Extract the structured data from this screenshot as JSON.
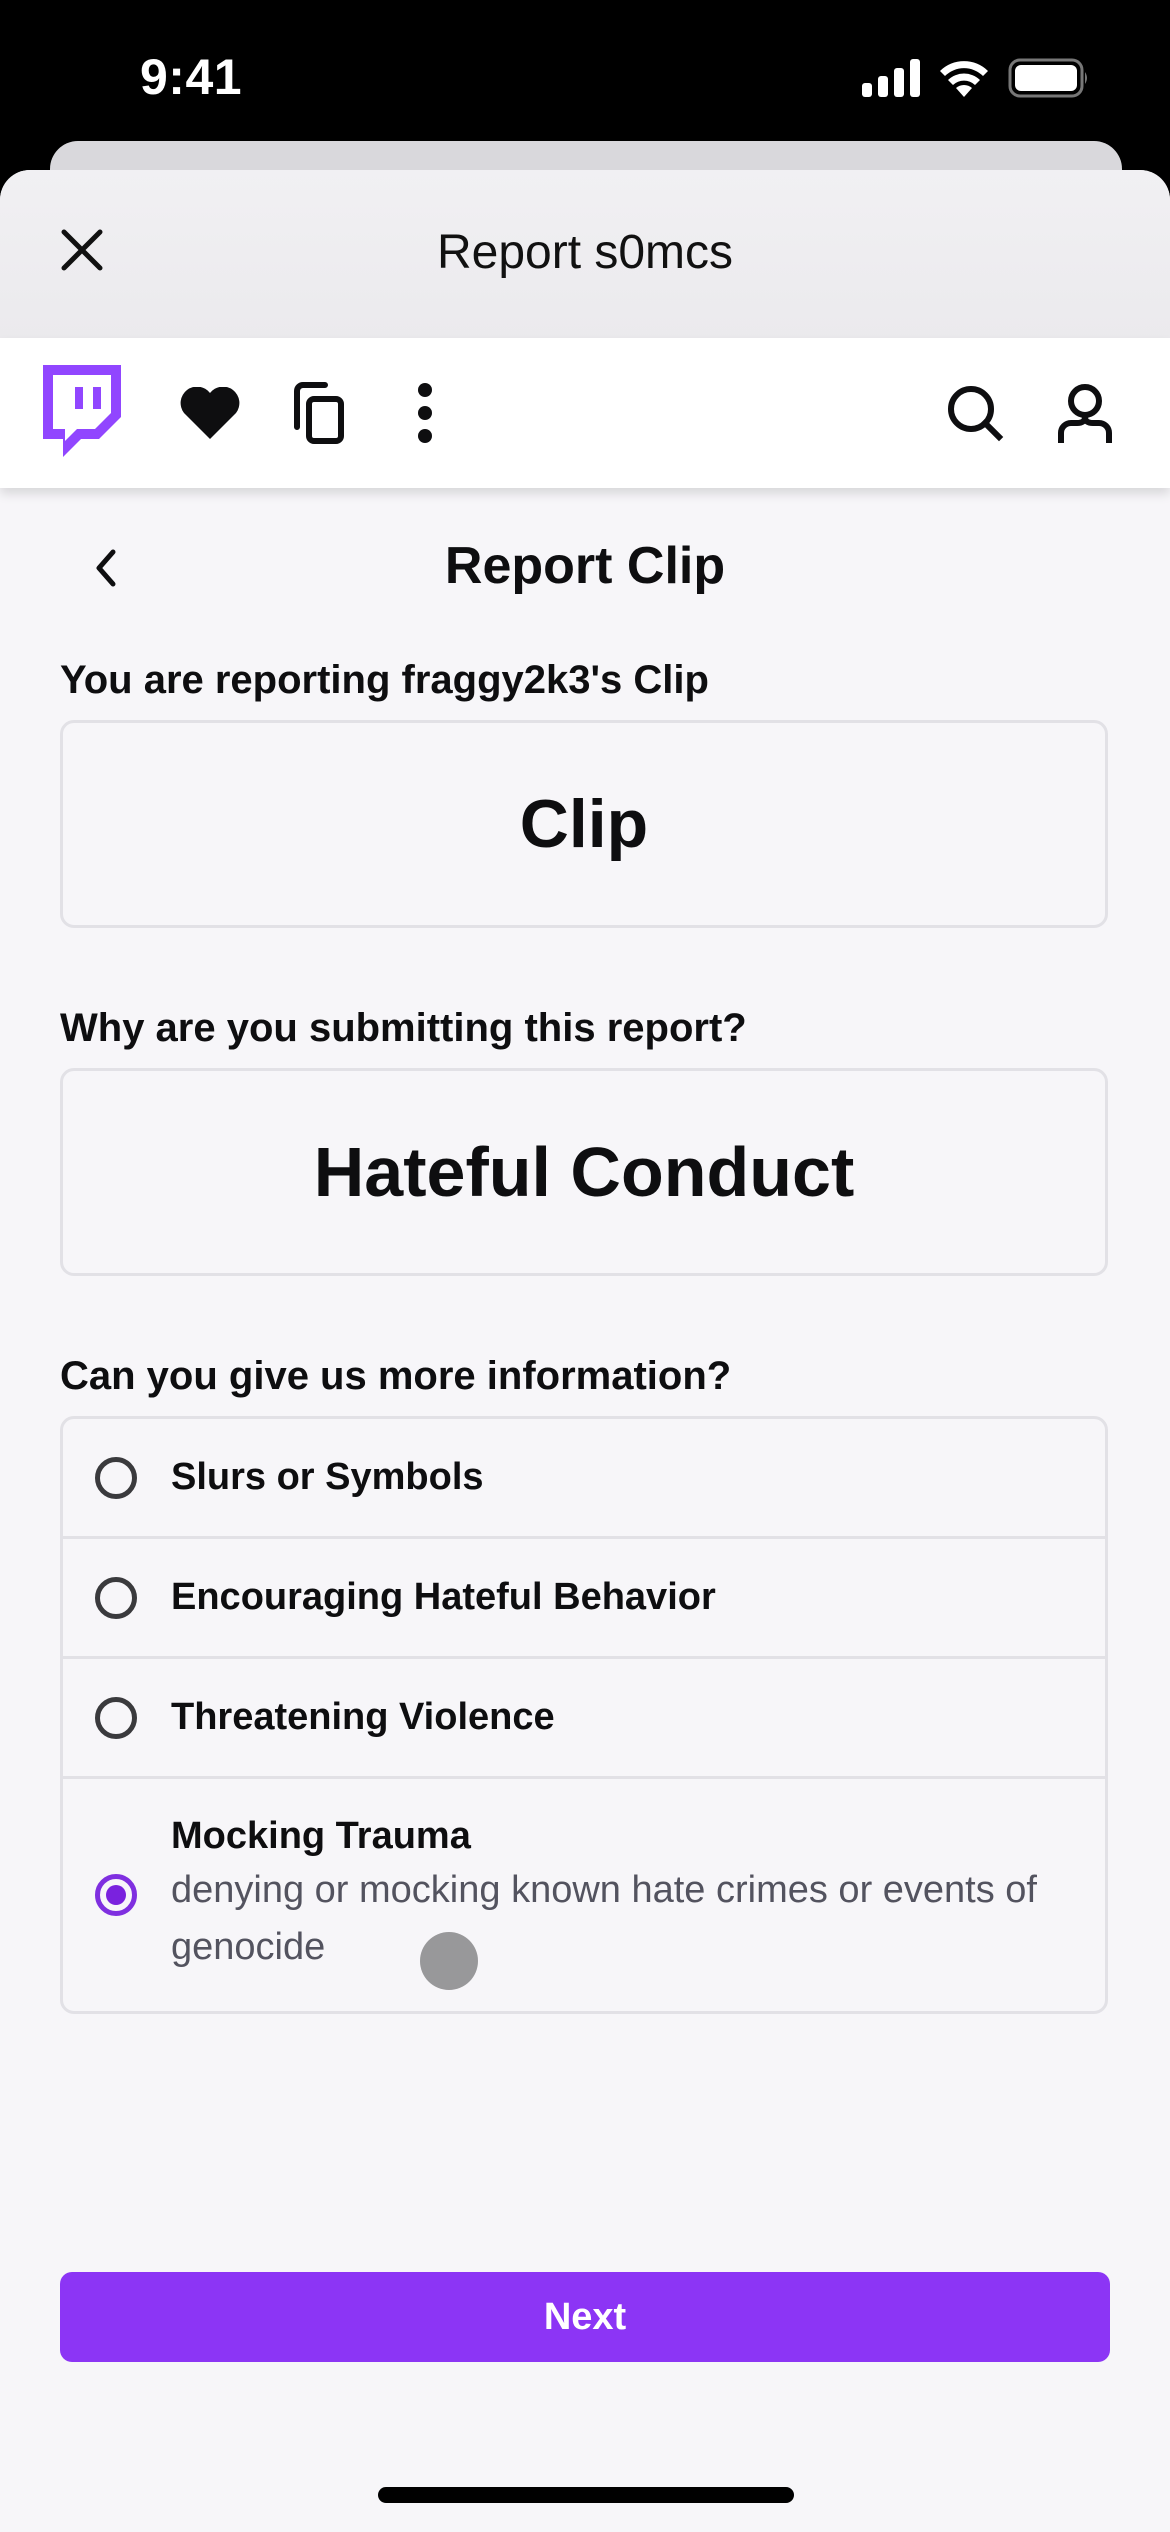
{
  "status_bar": {
    "time": "9:41",
    "icons": [
      "cellular-signal-icon",
      "wifi-icon",
      "battery-icon"
    ]
  },
  "sheet": {
    "title": "Report s0mcs",
    "close_icon": "close-icon"
  },
  "toolbar": {
    "left_icons": [
      "twitch-logo",
      "heart-icon",
      "copy-icon",
      "more-vertical-icon"
    ],
    "right_icons": [
      "search-icon",
      "user-icon"
    ]
  },
  "page": {
    "back_icon": "chevron-left-icon",
    "title": "Report Clip",
    "reporting_label": "You are reporting fraggy2k3's Clip",
    "content_type": "Clip",
    "reason_label": "Why are you submitting this report?",
    "reason_value": "Hateful Conduct",
    "more_info_label": "Can you give us more information?",
    "options": [
      {
        "label": "Slurs or Symbols",
        "description": "",
        "selected": false
      },
      {
        "label": "Encouraging Hateful Behavior",
        "description": "",
        "selected": false
      },
      {
        "label": "Threatening Violence",
        "description": "",
        "selected": false
      },
      {
        "label": "Mocking Trauma",
        "description": "denying or mocking known hate crimes or events of genocide",
        "selected": true
      }
    ],
    "next_label": "Next"
  },
  "colors": {
    "accent": "#8c35f5",
    "radio_selected": "#7a22de",
    "background": "#f7f6f9",
    "text": "#0e0e10"
  }
}
